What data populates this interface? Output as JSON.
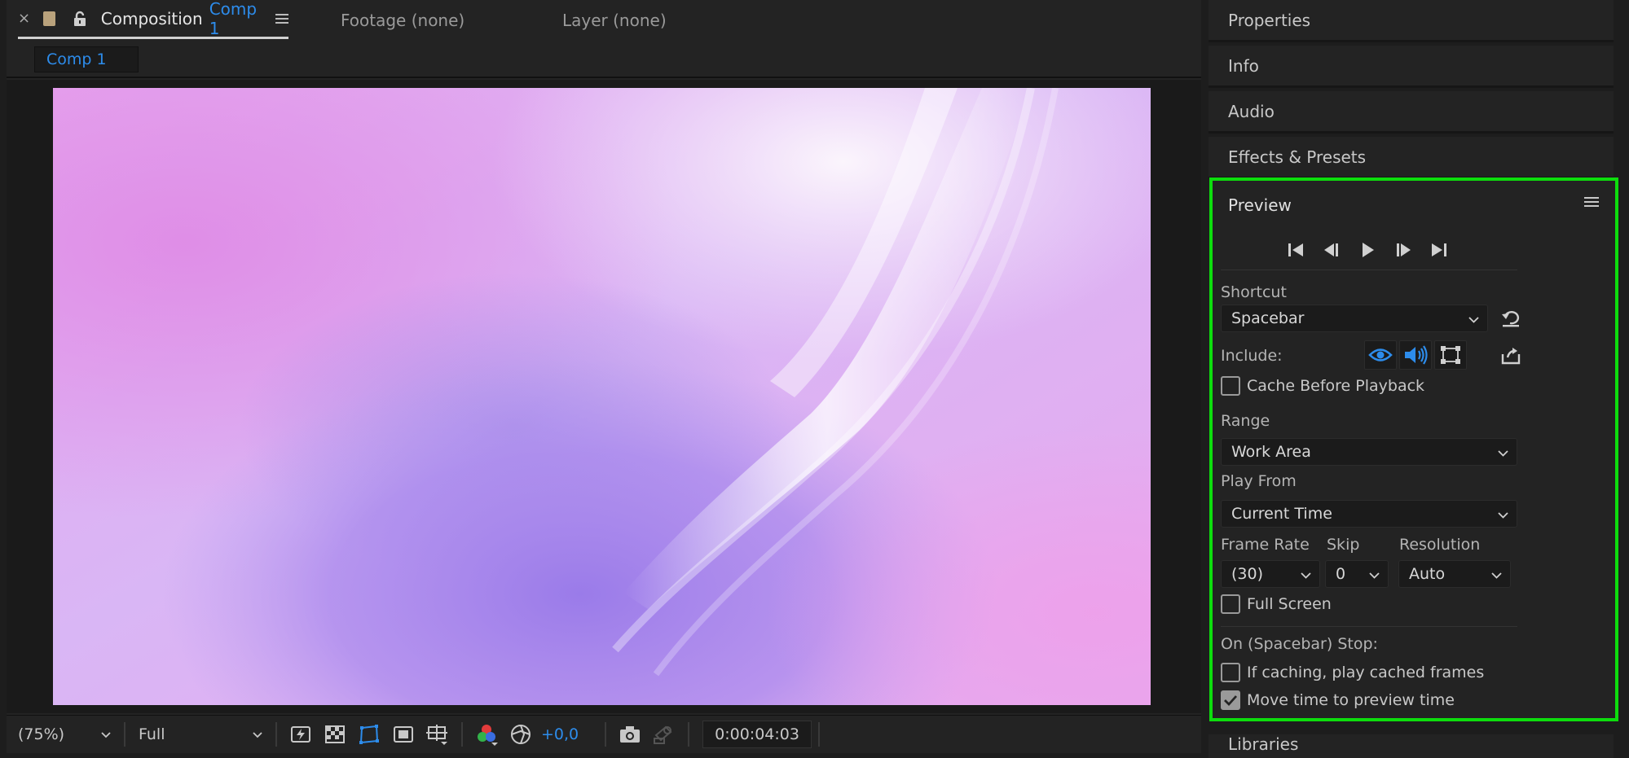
{
  "composition_tabs": {
    "close": "×",
    "composition_prefix": "Composition",
    "composition_name": "Comp 1",
    "footage": "Footage (none)",
    "layer": "Layer (none)"
  },
  "comp_subtab": "Comp 1",
  "viewer_toolbar": {
    "zoom": "(75%)",
    "resolution": "Full",
    "exposure_offset": "+0,0",
    "timecode": "0:00:04:03"
  },
  "right_panels": {
    "properties": "Properties",
    "info": "Info",
    "audio": "Audio",
    "effects_presets": "Effects & Presets",
    "libraries": "Libraries"
  },
  "preview": {
    "title": "Preview",
    "shortcut_label": "Shortcut",
    "shortcut_value": "Spacebar",
    "include_label": "Include:",
    "cache_before_playback": "Cache Before Playback",
    "cache_before_playback_checked": false,
    "range_label": "Range",
    "range_value": "Work Area",
    "play_from_label": "Play From",
    "play_from_value": "Current Time",
    "frame_rate_label": "Frame Rate",
    "frame_rate_value": "(30)",
    "skip_label": "Skip",
    "skip_value": "0",
    "resolution_label": "Resolution",
    "resolution_value": "Auto",
    "full_screen": "Full Screen",
    "full_screen_checked": false,
    "on_stop_label": "On (Spacebar) Stop:",
    "if_caching": "If caching, play cached frames",
    "if_caching_checked": false,
    "move_time": "Move time to preview time",
    "move_time_checked": true
  },
  "colors": {
    "accent_blue": "#2d8ceb",
    "highlight_green": "#0ddd0d",
    "panel_bg": "#232323"
  },
  "icons": {
    "tab_swatch": "color-swatch-icon",
    "tab_lock": "lock-icon",
    "transport": [
      "first-frame-icon",
      "previous-frame-icon",
      "play-icon",
      "next-frame-icon",
      "last-frame-icon"
    ],
    "include": [
      "video-eye-icon",
      "audio-speaker-icon",
      "overlay-bounds-icon"
    ]
  }
}
